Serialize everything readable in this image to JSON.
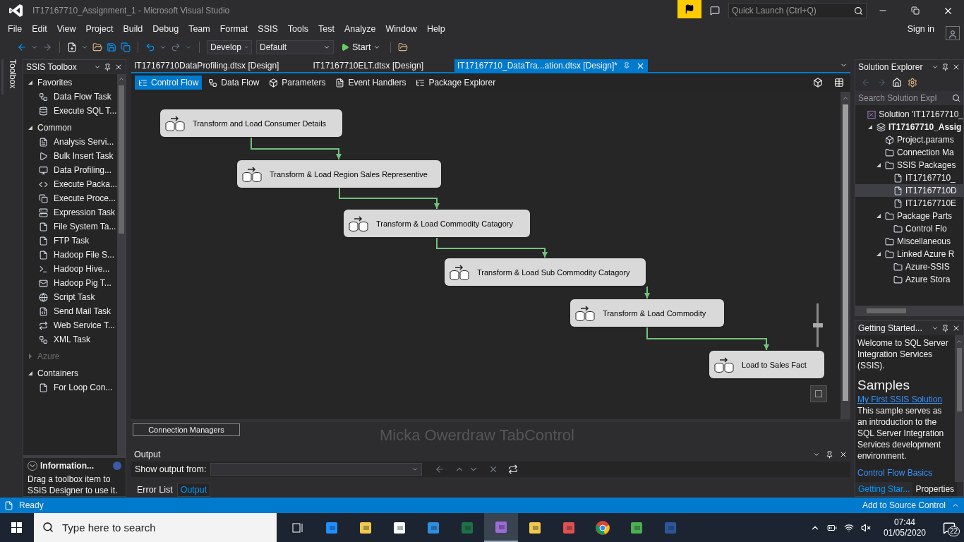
{
  "window": {
    "title": "IT17167710_Assignment_1 - Microsoft Visual Studio"
  },
  "quick_launch": {
    "placeholder": "Quick Launch (Ctrl+Q)"
  },
  "menu": [
    "File",
    "Edit",
    "View",
    "Project",
    "Build",
    "Debug",
    "Team",
    "Format",
    "SSIS",
    "Tools",
    "Test",
    "Analyze",
    "Window",
    "Help"
  ],
  "sign_in": "Sign in",
  "toolbar": {
    "configuration": "Develop",
    "platform": "Default",
    "start": "Start"
  },
  "toolbox_strip": "Toolbox",
  "toolbox": {
    "title": "SSIS Toolbox",
    "groups": [
      {
        "label": "Favorites",
        "expanded": true,
        "disabled": false,
        "items": [
          "Data Flow Task",
          "Execute SQL T..."
        ]
      },
      {
        "label": "Common",
        "expanded": true,
        "disabled": false,
        "items": [
          "Analysis Servi...",
          "Bulk Insert Task",
          "Data Profiling...",
          "Execute Packa...",
          "Execute Proce...",
          "Expression Task",
          "File System Ta...",
          "FTP Task",
          "Hadoop File S...",
          "Hadoop Hive...",
          "Hadoop Pig T...",
          "Script Task",
          "Send Mail Task",
          "Web Service T...",
          "XML Task"
        ]
      },
      {
        "label": "Azure",
        "expanded": false,
        "disabled": true
      },
      {
        "label": "Containers",
        "expanded": true,
        "disabled": false,
        "items": [
          "For Loop Con..."
        ]
      }
    ]
  },
  "information": {
    "title": "Information...",
    "text": "Drag a toolbox item to SSIS Designer to use it."
  },
  "document_tabs": [
    {
      "label": "IT17167710DataProfiling.dtsx [Design]",
      "selected": false
    },
    {
      "label": "IT17167710ELT.dtsx [Design]",
      "selected": false
    },
    {
      "label": "IT17167710_DataTra...ation.dtsx [Design]*",
      "selected": true
    }
  ],
  "designer_tabs": [
    {
      "label": "Control Flow",
      "selected": true
    },
    {
      "label": "Data Flow",
      "selected": false
    },
    {
      "label": "Parameters",
      "selected": false
    },
    {
      "label": "Event Handlers",
      "selected": false
    },
    {
      "label": "Package Explorer",
      "selected": false
    }
  ],
  "tasks": [
    "Transform and Load Consumer Details",
    "Transform & Load Region Sales Representive",
    "Transform & Load Commodity Catagory",
    "Transform & Load Sub Commodity Catagory",
    "Transform & Load Commodity",
    "Load to Sales Fact"
  ],
  "zoom_slider": {
    "level": 0.5
  },
  "connection_managers_tab": "Connection Managers",
  "overlay_text": "Micka Owerdraw TabControl",
  "output": {
    "title": "Output",
    "show_from_label": "Show output from:",
    "tabs": [
      {
        "label": "Error List",
        "selected": false
      },
      {
        "label": "Output",
        "selected": true
      }
    ]
  },
  "solution_explorer": {
    "title": "Solution Explorer",
    "search_placeholder": "Search Solution Expl",
    "tree": [
      {
        "label": "Solution 'IT17167710_",
        "kind": "solution",
        "selected": false,
        "children": [
          {
            "label": "IT17167710_Assig",
            "kind": "project",
            "expanded": true,
            "selected": false,
            "children": [
              {
                "label": "Project.params",
                "kind": "params",
                "selected": false
              },
              {
                "label": "Connection Ma",
                "kind": "folder",
                "selected": false
              },
              {
                "label": "SSIS Packages",
                "kind": "folder",
                "expanded": true,
                "selected": false,
                "children": [
                  {
                    "label": "IT17167710_",
                    "kind": "package",
                    "selected": false
                  },
                  {
                    "label": "IT17167710D",
                    "kind": "package",
                    "selected": true
                  },
                  {
                    "label": "IT17167710E",
                    "kind": "package",
                    "selected": false
                  }
                ]
              },
              {
                "label": "Package Parts",
                "kind": "folder",
                "expanded": true,
                "selected": false,
                "children": [
                  {
                    "label": "Control Flo",
                    "kind": "folder",
                    "selected": false
                  }
                ]
              },
              {
                "label": "Miscellaneous",
                "kind": "folder",
                "selected": false
              },
              {
                "label": "Linked Azure R",
                "kind": "folder",
                "expanded": true,
                "selected": false,
                "children": [
                  {
                    "label": "Azure-SSIS",
                    "kind": "folder",
                    "selected": false
                  },
                  {
                    "label": "Azure Stora",
                    "kind": "folder",
                    "selected": false
                  }
                ]
              }
            ]
          }
        ]
      }
    ]
  },
  "getting_started": {
    "title": "Getting Started...",
    "intro": "Welcome to SQL Server Integration Services (SSIS).",
    "heading": "Samples",
    "link": "My First SSIS Solution",
    "body": "This sample serves as an introduction to the SQL Server Integration Services development environment.",
    "link2": "Control Flow Basics"
  },
  "right_tabs": [
    {
      "label": "Getting Star...",
      "selected": true
    },
    {
      "label": "Properties",
      "selected": false
    }
  ],
  "status_bar": {
    "text": "Ready",
    "source_control": "Add to Source Control"
  },
  "taskbar": {
    "search_placeholder": "Type here to search",
    "time": "07:44",
    "date": "01/05/2020",
    "notifications": "22"
  }
}
